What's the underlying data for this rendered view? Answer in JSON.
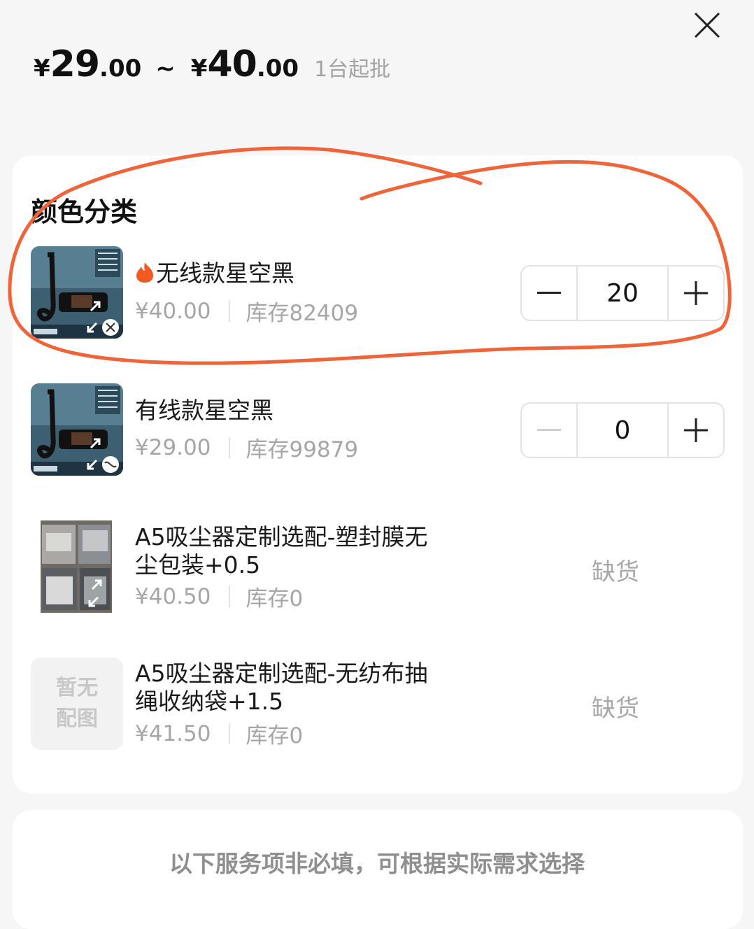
{
  "header": {
    "currency": "¥",
    "price_min_int": "29",
    "price_min_dec": ".00",
    "range_sep": "~",
    "price_max_int": "40",
    "price_max_dec": ".00",
    "min_order": "1台起批"
  },
  "section": {
    "title": "颜色分类"
  },
  "items": [
    {
      "name": "无线款星空黑",
      "hot": true,
      "price": "¥40.00",
      "stock": "库存82409",
      "quantity": "20",
      "thumb": "product-photo"
    },
    {
      "name": "有线款星空黑",
      "hot": false,
      "price": "¥29.00",
      "stock": "库存99879",
      "quantity": "0",
      "thumb": "product-photo"
    },
    {
      "name_line1": "A5吸尘器定制选配-塑封膜无",
      "name_line2": "尘包装+0.5",
      "price": "¥40.50",
      "stock": "库存0",
      "status": "缺货",
      "thumb": "packaging-photo"
    },
    {
      "name_line1": "A5吸尘器定制选配-无纺布抽",
      "name_line2": "绳收纳袋+1.5",
      "price": "¥41.50",
      "stock": "库存0",
      "status": "缺货",
      "thumb_text_line1": "暂无",
      "thumb_text_line2": "配图"
    }
  ],
  "footer": {
    "note": "以下服务项非必填，可根据实际需求选择"
  },
  "colors": {
    "annotation": "#f0643a",
    "fire": "#f25a22",
    "muted": "#a6a6a6"
  }
}
